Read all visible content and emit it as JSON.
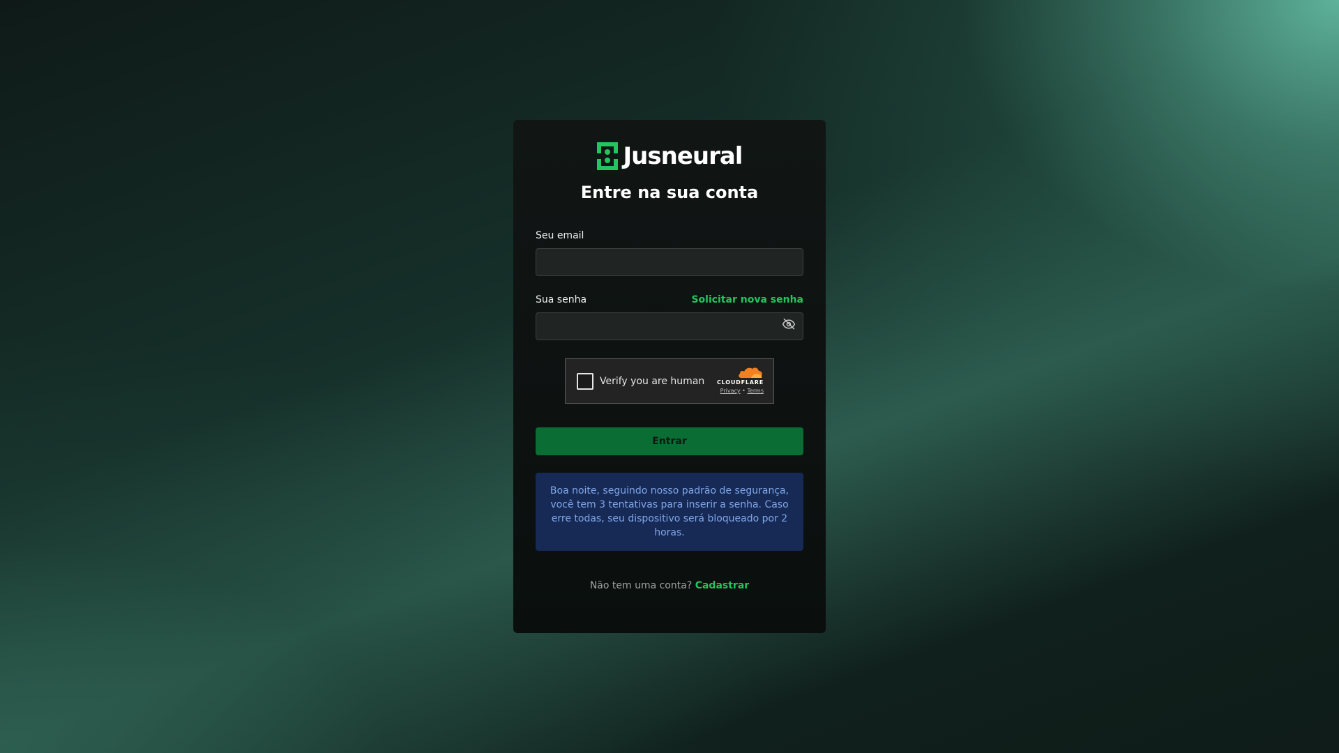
{
  "brand": {
    "name": "Jusneural",
    "logo_icon": "jusneural-logo-icon",
    "accent_color": "#22c55e"
  },
  "login": {
    "title": "Entre na sua conta",
    "email_label": "Seu email",
    "email_value": "",
    "password_label": "Sua senha",
    "password_value": "",
    "forgot_password_link": "Solicitar nova senha",
    "toggle_visibility_icon": "eye-off-icon",
    "submit_label": "Entrar",
    "submit_color": "#0a6e34"
  },
  "captcha": {
    "label": "Verify you are human",
    "provider": "CLOUDFLARE",
    "privacy_link": "Privacy",
    "separator": "•",
    "terms_link": "Terms"
  },
  "notice": {
    "text": "Boa noite, seguindo nosso padrão de segurança, você tem 3 tentativas para inserir a senha. Caso erre todas, seu dispositivo será bloqueado por 2 horas.",
    "background_color": "#172a56",
    "text_color": "#7fa7e8"
  },
  "signup": {
    "prompt": "Não tem uma conta?",
    "link": "Cadastrar"
  }
}
